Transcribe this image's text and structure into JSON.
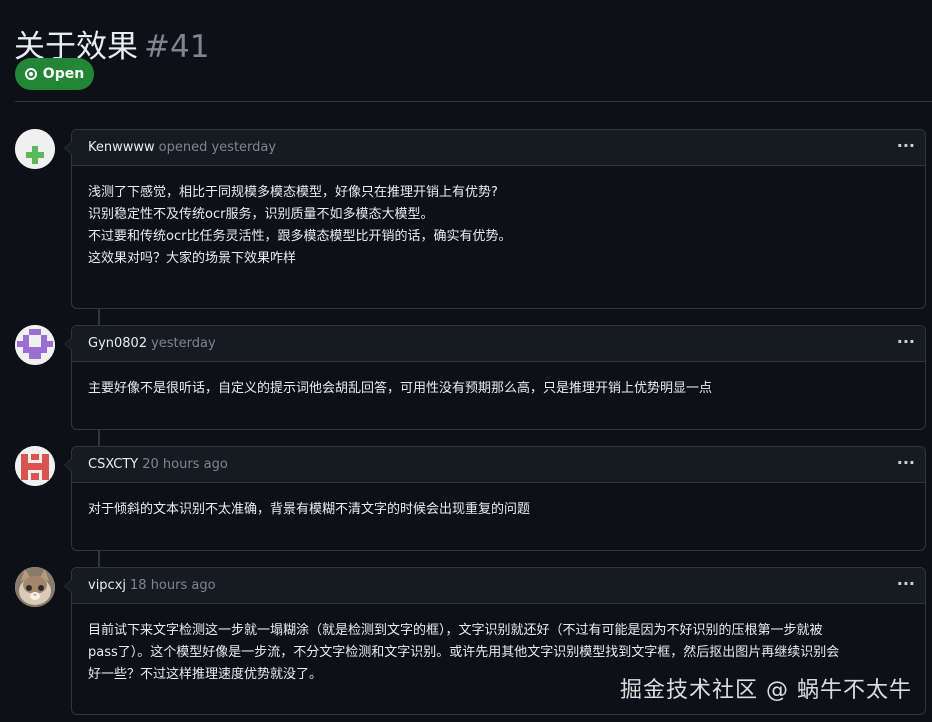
{
  "issue": {
    "title": "关于效果",
    "number": "#41",
    "state": "Open"
  },
  "comments": [
    {
      "author": "Kenwwww",
      "meta": "opened yesterday",
      "menu": "···",
      "lines": [
        "浅测了下感觉，相比于同规模多模态模型，好像只在推理开销上有优势?",
        "识别稳定性不及传统ocr服务，识别质量不如多模态大模型。",
        "不过要和传统ocr比任务灵活性，跟多模态模型比开销的话，确实有优势。",
        "这效果对吗？大家的场景下效果咋样"
      ]
    },
    {
      "author": "Gyn0802",
      "meta": "yesterday",
      "menu": "···",
      "lines": [
        "主要好像不是很听话，自定义的提示词他会胡乱回答，可用性没有预期那么高，只是推理开销上优势明显一点"
      ]
    },
    {
      "author": "CSXCTY",
      "meta": "20 hours ago",
      "menu": "···",
      "lines": [
        "对于倾斜的文本识别不太准确，背景有模糊不清文字的时候会出现重复的问题"
      ]
    },
    {
      "author": "vipcxj",
      "meta": "18 hours ago",
      "menu": "···",
      "lines": [
        "目前试下来文字检测这一步就一塌糊涂（就是检测到文字的框），文字识别就还好（不过有可能是因为不好识别的压根第一步就被",
        "pass了）。这个模型好像是一步流，不分文字检测和文字识别。或许先用其他文字识别模型找到文字框，然后抠出图片再继续识别会",
        "好一些？不过这样推理速度优势就没了。"
      ]
    }
  ],
  "watermark": "掘金技术社区 @ 蜗牛不太牛",
  "colors": {
    "background": "#0d1117",
    "header_bg": "#161b22",
    "border": "#30363d",
    "open_green": "#238636",
    "muted_text": "#7d8590"
  }
}
